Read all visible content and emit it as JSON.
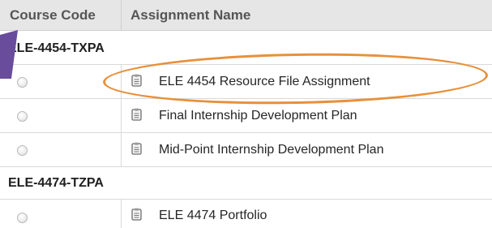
{
  "table": {
    "headers": {
      "course_code": "Course Code",
      "assignment_name": "Assignment Name"
    },
    "groups": [
      {
        "code": "ELE-4454-TXPA",
        "items": [
          {
            "label": "ELE 4454 Resource File Assignment",
            "highlighted": true
          },
          {
            "label": "Final Internship Development Plan"
          },
          {
            "label": "Mid-Point Internship Development Plan"
          }
        ]
      },
      {
        "code": "ELE-4474-TZPA",
        "items": [
          {
            "label": "ELE 4474 Portfolio"
          }
        ]
      }
    ]
  },
  "annotation": {
    "highlight_color": "#e8903a",
    "arrow_color": "#6a4c9c"
  }
}
